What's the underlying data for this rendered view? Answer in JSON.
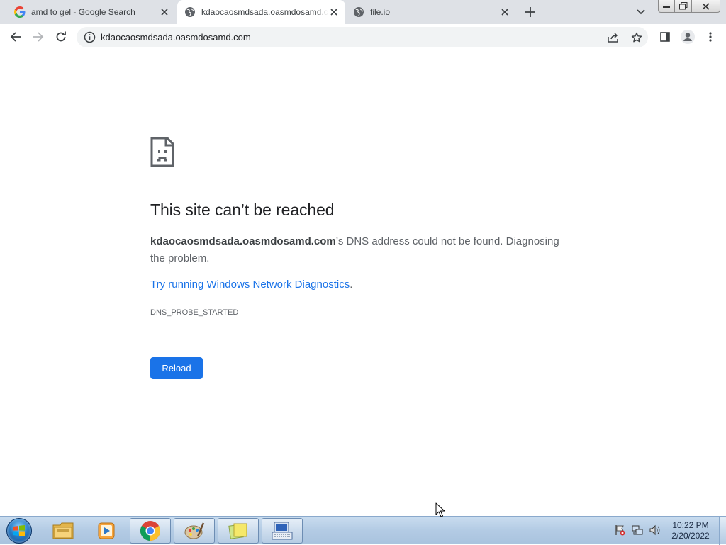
{
  "tabs": [
    {
      "title": "amd to gel - Google Search",
      "favicon": "google-g-icon",
      "active": false
    },
    {
      "title": "kdaocaosmdsada.oasmdosamd.com",
      "favicon": "globe-icon",
      "active": true
    },
    {
      "title": "file.io",
      "favicon": "globe-icon",
      "active": false
    }
  ],
  "toolbar": {
    "url": "kdaocaosmdsada.oasmdosamd.com"
  },
  "error": {
    "title": "This site can’t be reached",
    "host": "kdaocaosmdsada.oasmdosamd.com",
    "message_suffix": "’s DNS address could not be found. Diagnosing the problem.",
    "suggestion_link": "Try running Windows Network Diagnostics",
    "suggestion_end": ".",
    "code": "DNS_PROBE_STARTED",
    "reload_label": "Reload"
  },
  "colors": {
    "accent": "#1a73e8",
    "tabstrip": "#dee1e6",
    "taskbar": "#b3cbe4"
  },
  "taskbar": {
    "items": [
      "windows-explorer-icon",
      "media-player-icon",
      "chrome-icon",
      "paint-icon",
      "sticky-notes-icon",
      "onscreen-keyboard-icon"
    ],
    "clock_time": "10:22 PM",
    "clock_date": "2/20/2022"
  }
}
